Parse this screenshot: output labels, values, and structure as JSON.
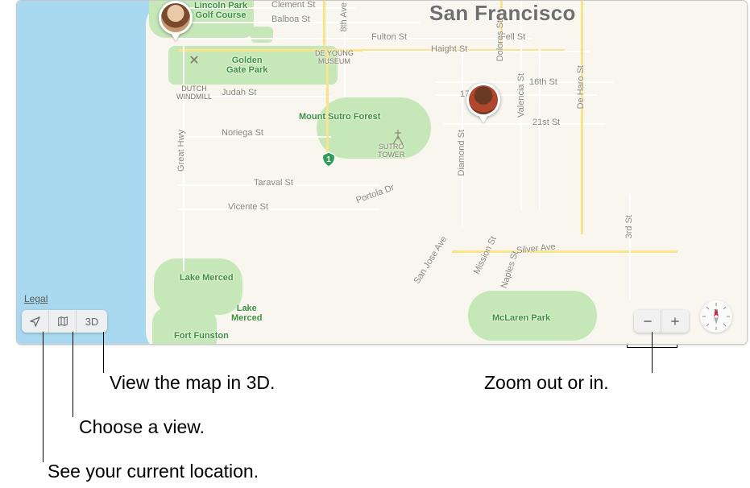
{
  "city": "San Francisco",
  "legal": "Legal",
  "threeD": "3D",
  "compass_letter": "N",
  "parks": {
    "lincoln": "Lincoln Park\nGolf Course",
    "ggp": "Golden\nGate Park",
    "deyoung": "DE YOUNG\nMUSEUM",
    "sutro_forest": "Mount Sutro Forest",
    "sutro_tower": "SUTRO\nTOWER",
    "merced": "Lake Merced",
    "merced2": "Lake\nMerced",
    "funston": "Fort Funston",
    "mclaren": "McLaren Park",
    "windmill": "DUTCH\nWINDMILL"
  },
  "streets": {
    "clement": "Clement St",
    "balboa": "Balboa St",
    "fulton": "Fulton St",
    "judah": "Judah St",
    "noriega": "Noriega St",
    "taraval": "Taraval St",
    "vicente": "Vicente St",
    "great_hwy": "Great Hwy",
    "haight": "Haight St",
    "fell": "Fell St",
    "seventeenth": "17th St",
    "sixteenth": "16th St",
    "twentyfirst": "21st St",
    "eighth": "8th Ave",
    "valencia": "Valencia St",
    "dolores": "Dolores St",
    "deharo": "De Haro St",
    "diamond": "Diamond St",
    "portola": "Portola Dr",
    "silver": "Silver Ave",
    "mission": "Mission St",
    "naples": "Naples St",
    "sanjose": "San Jose Ave",
    "third": "3rd St"
  },
  "callouts": {
    "threeD": "View the map in 3D.",
    "view": "Choose a view.",
    "location": "See your current location.",
    "zoom": "Zoom out or in."
  }
}
